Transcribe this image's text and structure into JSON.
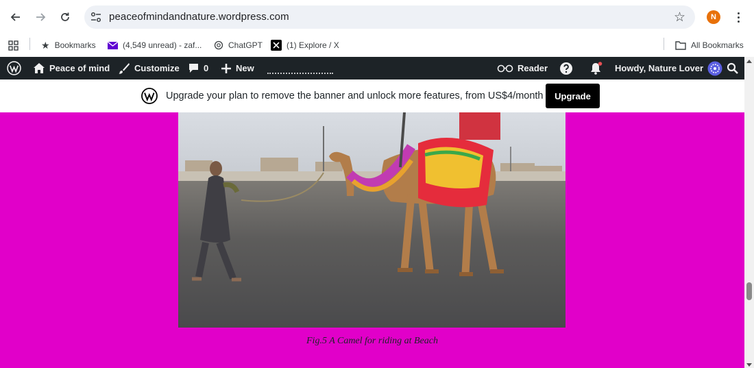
{
  "browser": {
    "url": "peaceofmindandnature.wordpress.com",
    "profile_initial": "N",
    "bookmarks": [
      {
        "label": "Bookmarks",
        "icon": "star-icon"
      },
      {
        "label": "(4,549 unread) - zaf...",
        "icon": "mail-icon"
      },
      {
        "label": "ChatGPT",
        "icon": "chatgpt-icon"
      },
      {
        "label": "(1) Explore / X",
        "icon": "x-icon"
      }
    ],
    "all_bookmarks_label": "All Bookmarks"
  },
  "adminbar": {
    "site_name": "Peace of mind",
    "customize": "Customize",
    "comments_count": "0",
    "new": "New",
    "reader": "Reader",
    "howdy": "Howdy, Nature Lover"
  },
  "banner": {
    "message": "Upgrade your plan to remove the banner and unlock more features, from US$4/month",
    "button": "Upgrade"
  },
  "content": {
    "caption": "Fig.5 A Camel for riding at Beach"
  },
  "colors": {
    "page_background": "#e100c9",
    "adminbar": "#1d2327",
    "profile": "#e8710a"
  }
}
